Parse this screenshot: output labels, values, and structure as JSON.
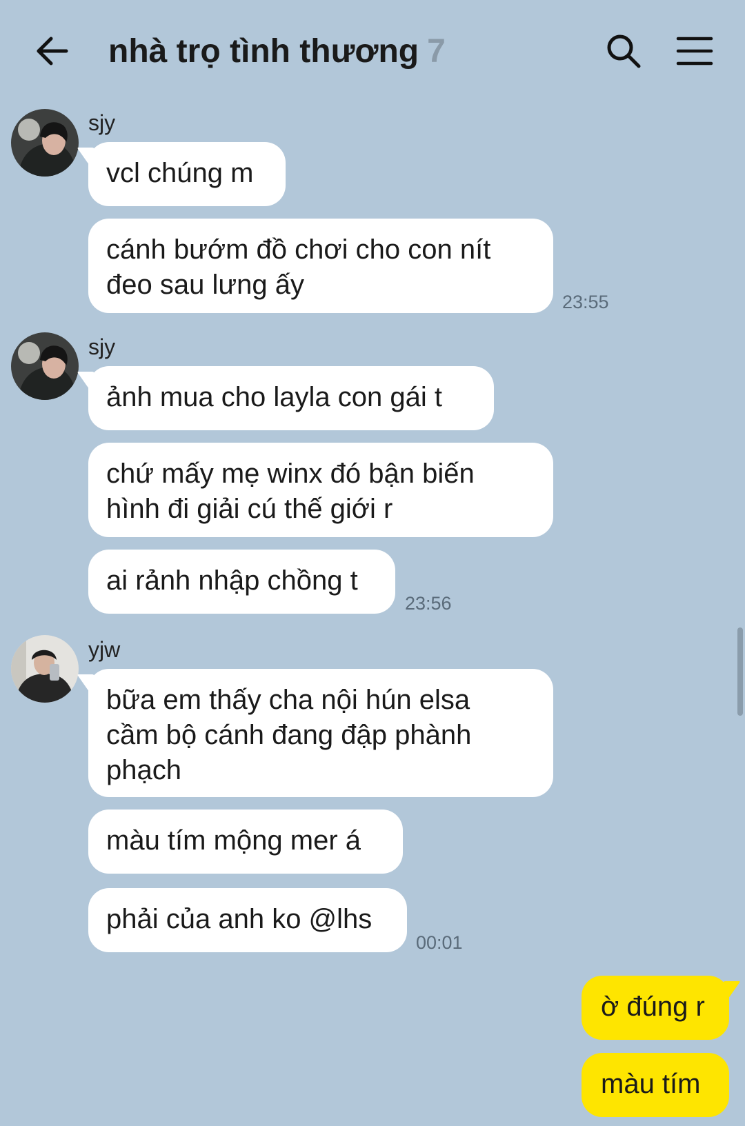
{
  "header": {
    "title": "nhà trọ tình thương",
    "member_count": "7",
    "back_icon": "arrow-left-icon",
    "search_icon": "search-icon",
    "menu_icon": "hamburger-menu-icon"
  },
  "messages": [
    {
      "sender": "sjy",
      "bubbles": [
        "vcl chúng m",
        "cánh bướm đồ chơi cho con nít\nđeo sau lưng ấy"
      ],
      "time": "23:55"
    },
    {
      "sender": "sjy",
      "bubbles": [
        "ảnh mua cho layla con gái t",
        "chứ mấy mẹ winx đó bận biến\nhình đi giải cú thế giới r",
        "ai rảnh nhập chồng t"
      ],
      "time": "23:56"
    },
    {
      "sender": "yjw",
      "bubbles": [
        "bữa em thấy cha nội hún elsa\ncầm bộ cánh đang đập phành\nphạch",
        "màu tím mộng mer á",
        "phải của anh ko @lhs"
      ],
      "time": "00:01"
    }
  ],
  "my_messages": [
    "ờ đúng r",
    "màu tím"
  ],
  "colors": {
    "background": "#b2c7d9",
    "my_bubble": "#fee500",
    "their_bubble": "#ffffff"
  }
}
